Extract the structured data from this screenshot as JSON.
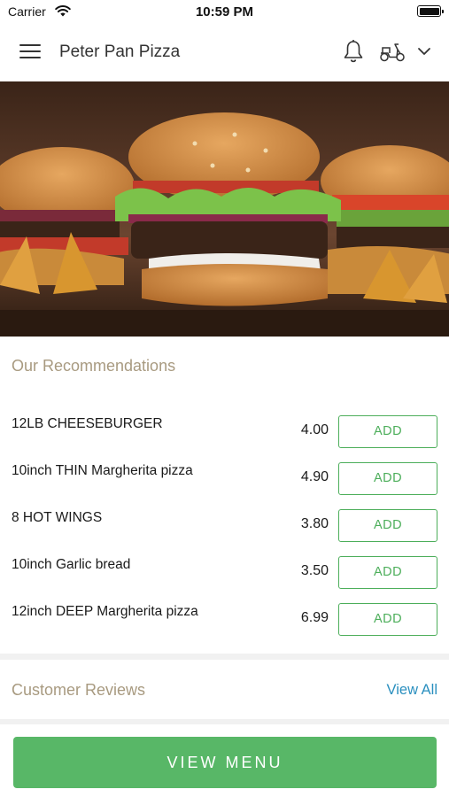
{
  "status_bar": {
    "carrier": "Carrier",
    "time": "10:59 PM"
  },
  "nav": {
    "title": "Peter Pan Pizza",
    "icons": [
      "hamburger-menu-icon",
      "bell-icon",
      "scooter-icon",
      "chevron-down-icon"
    ]
  },
  "recommendations": {
    "heading": "Our Recommendations",
    "items": [
      {
        "name": "12LB CHEESEBURGER",
        "price": "4.00",
        "button": "ADD"
      },
      {
        "name": "10inch THIN Margherita pizza",
        "price": "4.90",
        "button": "ADD"
      },
      {
        "name": "8 HOT WINGS",
        "price": "3.80",
        "button": "ADD"
      },
      {
        "name": "10inch Garlic bread",
        "price": "3.50",
        "button": "ADD"
      },
      {
        "name": "12inch DEEP Margherita pizza",
        "price": "6.99",
        "button": "ADD"
      }
    ]
  },
  "reviews": {
    "heading": "Customer Reviews",
    "view_all": "View All"
  },
  "footer": {
    "view_menu": "VIEW MENU"
  },
  "colors": {
    "accent_green": "#58b767",
    "heading_tan": "#a89a80",
    "link_blue": "#2a8fbf"
  }
}
